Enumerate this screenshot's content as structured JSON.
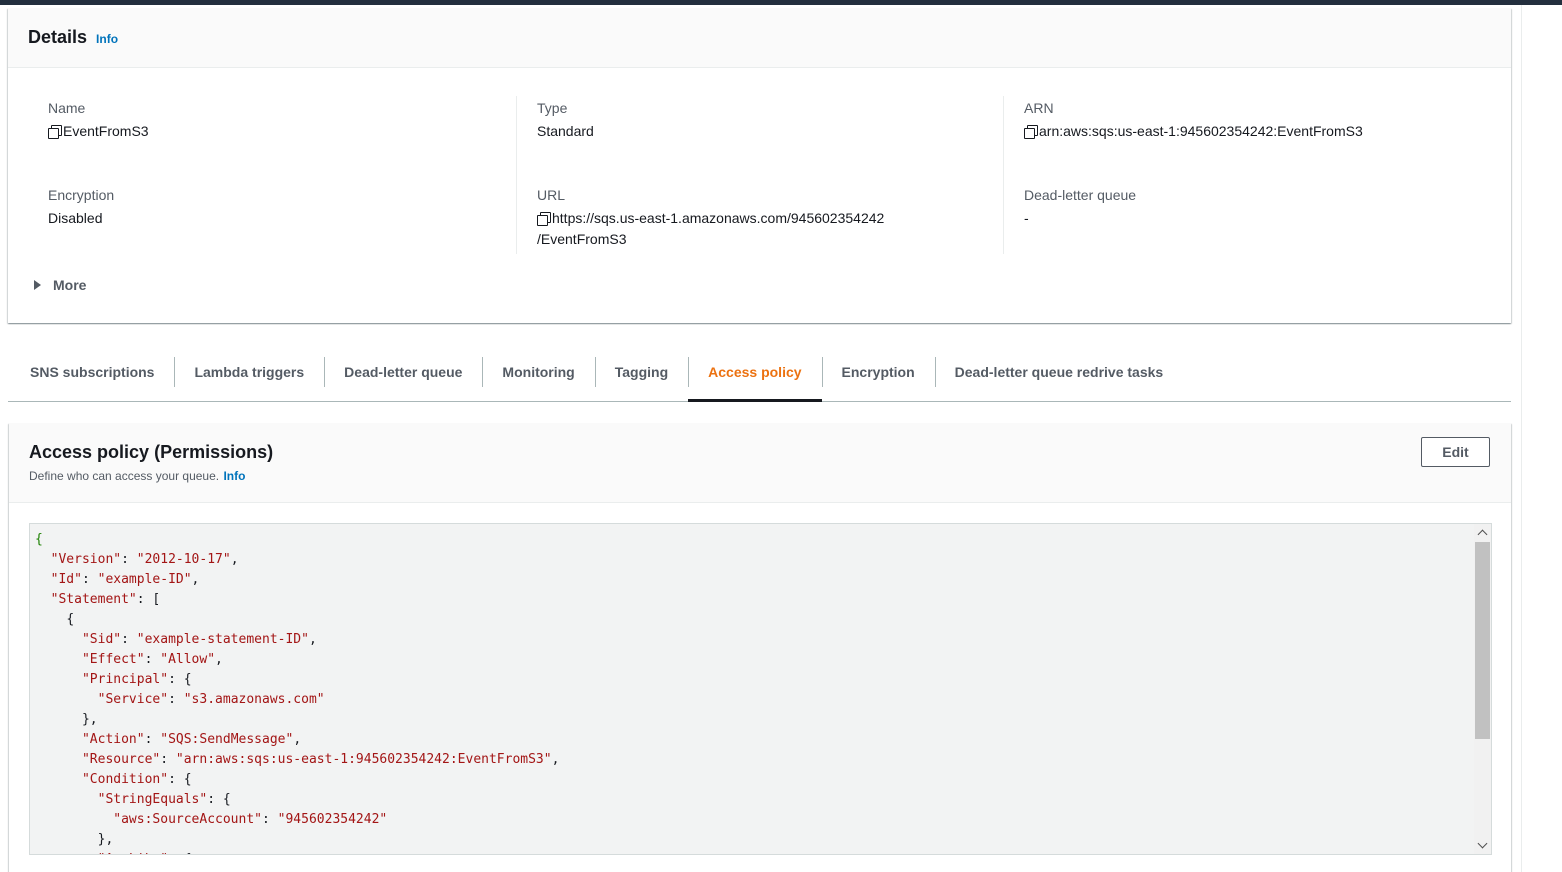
{
  "details": {
    "title": "Details",
    "info": "Info",
    "fields": {
      "name": {
        "label": "Name",
        "value": "EventFromS3"
      },
      "type": {
        "label": "Type",
        "value": "Standard"
      },
      "arn": {
        "label": "ARN",
        "value": "arn:aws:sqs:us-east-1:945602354242:EventFromS3"
      },
      "encryption": {
        "label": "Encryption",
        "value": "Disabled"
      },
      "url": {
        "label": "URL",
        "value_line1": "https://sqs.us-east-1.amazonaws.com/945602354242",
        "value_line2": "/EventFromS3"
      },
      "dlq": {
        "label": "Dead-letter queue",
        "value": "-"
      }
    },
    "more": "More"
  },
  "tabs": [
    {
      "label": "SNS subscriptions"
    },
    {
      "label": "Lambda triggers"
    },
    {
      "label": "Dead-letter queue"
    },
    {
      "label": "Monitoring"
    },
    {
      "label": "Tagging"
    },
    {
      "label": "Access policy",
      "active": true
    },
    {
      "label": "Encryption"
    },
    {
      "label": "Dead-letter queue redrive tasks"
    }
  ],
  "policy": {
    "title": "Access policy (Permissions)",
    "description": "Define who can access your queue.",
    "info": "Info",
    "edit_label": "Edit",
    "code_lines": [
      {
        "indent": "",
        "parts": [
          [
            "g",
            "{"
          ]
        ]
      },
      {
        "indent": "  ",
        "parts": [
          [
            "k",
            "\"Version\""
          ],
          [
            "b",
            ": "
          ],
          [
            "s",
            "\"2012-10-17\""
          ],
          [
            "b",
            ","
          ]
        ]
      },
      {
        "indent": "  ",
        "parts": [
          [
            "k",
            "\"Id\""
          ],
          [
            "b",
            ": "
          ],
          [
            "s",
            "\"example-ID\""
          ],
          [
            "b",
            ","
          ]
        ]
      },
      {
        "indent": "  ",
        "parts": [
          [
            "k",
            "\"Statement\""
          ],
          [
            "b",
            ": ["
          ]
        ]
      },
      {
        "indent": "    ",
        "parts": [
          [
            "b",
            "{"
          ]
        ]
      },
      {
        "indent": "      ",
        "parts": [
          [
            "k",
            "\"Sid\""
          ],
          [
            "b",
            ": "
          ],
          [
            "s",
            "\"example-statement-ID\""
          ],
          [
            "b",
            ","
          ]
        ]
      },
      {
        "indent": "      ",
        "parts": [
          [
            "k",
            "\"Effect\""
          ],
          [
            "b",
            ": "
          ],
          [
            "s",
            "\"Allow\""
          ],
          [
            "b",
            ","
          ]
        ]
      },
      {
        "indent": "      ",
        "parts": [
          [
            "k",
            "\"Principal\""
          ],
          [
            "b",
            ": {"
          ]
        ]
      },
      {
        "indent": "        ",
        "parts": [
          [
            "k",
            "\"Service\""
          ],
          [
            "b",
            ": "
          ],
          [
            "s",
            "\"s3.amazonaws.com\""
          ]
        ]
      },
      {
        "indent": "      ",
        "parts": [
          [
            "b",
            "},"
          ]
        ]
      },
      {
        "indent": "      ",
        "parts": [
          [
            "k",
            "\"Action\""
          ],
          [
            "b",
            ": "
          ],
          [
            "s",
            "\"SQS:SendMessage\""
          ],
          [
            "b",
            ","
          ]
        ]
      },
      {
        "indent": "      ",
        "parts": [
          [
            "k",
            "\"Resource\""
          ],
          [
            "b",
            ": "
          ],
          [
            "s",
            "\"arn:aws:sqs:us-east-1:945602354242:EventFromS3\""
          ],
          [
            "b",
            ","
          ]
        ]
      },
      {
        "indent": "      ",
        "parts": [
          [
            "k",
            "\"Condition\""
          ],
          [
            "b",
            ": {"
          ]
        ]
      },
      {
        "indent": "        ",
        "parts": [
          [
            "k",
            "\"StringEquals\""
          ],
          [
            "b",
            ": {"
          ]
        ]
      },
      {
        "indent": "          ",
        "parts": [
          [
            "k",
            "\"aws:SourceAccount\""
          ],
          [
            "b",
            ": "
          ],
          [
            "s",
            "\"945602354242\""
          ]
        ]
      },
      {
        "indent": "        ",
        "parts": [
          [
            "b",
            "},"
          ]
        ]
      },
      {
        "indent": "        ",
        "parts": [
          [
            "k",
            "\"ArnLike\""
          ],
          [
            "b",
            ": {"
          ]
        ]
      }
    ]
  }
}
